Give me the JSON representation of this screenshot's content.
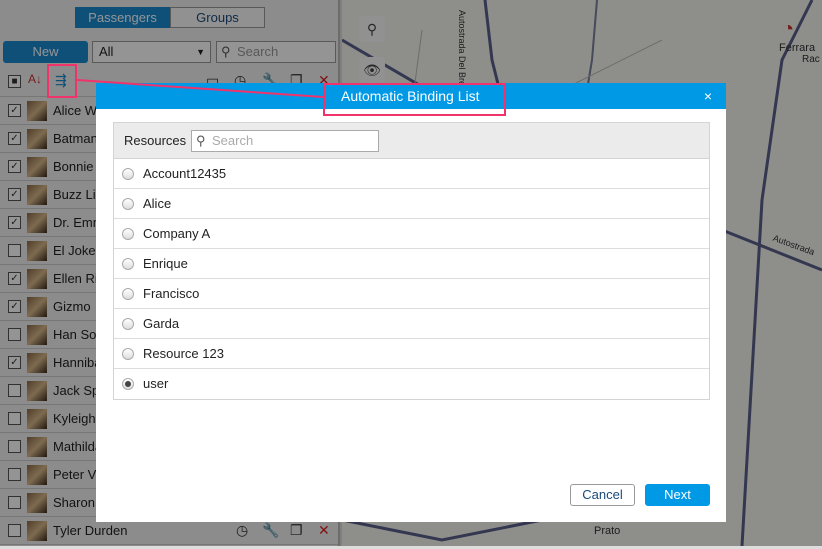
{
  "left_panel": {
    "tabs": [
      {
        "label": "Passengers",
        "active": true
      },
      {
        "label": "Groups",
        "active": false
      }
    ],
    "new_label": "New",
    "filter_value": "All",
    "search_placeholder": "Search",
    "rows": [
      {
        "name": "Alice White",
        "checked": true
      },
      {
        "name": "Batman",
        "checked": true
      },
      {
        "name": "Bonnie Parker",
        "checked": true
      },
      {
        "name": "Buzz Lightyear",
        "checked": true
      },
      {
        "name": "Dr. Emmett Brown",
        "checked": true
      },
      {
        "name": "El Joker",
        "checked": false
      },
      {
        "name": "Ellen Ripley",
        "checked": true
      },
      {
        "name": "Gizmo",
        "checked": true
      },
      {
        "name": "Han Solo",
        "checked": false
      },
      {
        "name": "Hannibal",
        "checked": true
      },
      {
        "name": "Jack Sparrow",
        "checked": false
      },
      {
        "name": "Kyleigh",
        "checked": false
      },
      {
        "name": "Mathilda",
        "checked": false
      },
      {
        "name": "Peter Venkman",
        "checked": false
      },
      {
        "name": "Sharon",
        "checked": false
      },
      {
        "name": "Tyler Durden",
        "checked": false
      }
    ]
  },
  "map": {
    "city": "Ferrara",
    "road": "Autostrada Del Brennero",
    "road2": "Autostrada",
    "town": "Prato",
    "partial": "Rac"
  },
  "dialog": {
    "title": "Automatic Binding List",
    "close": "×",
    "resources_label": "Resources",
    "search_placeholder": "Search",
    "items": [
      {
        "label": "Account12435",
        "selected": false
      },
      {
        "label": "Alice",
        "selected": false
      },
      {
        "label": "Company A",
        "selected": false
      },
      {
        "label": "Enrique",
        "selected": false
      },
      {
        "label": "Francisco",
        "selected": false
      },
      {
        "label": "Garda",
        "selected": false
      },
      {
        "label": "Resource 123",
        "selected": false
      },
      {
        "label": "user",
        "selected": true
      }
    ],
    "cancel": "Cancel",
    "next": "Next"
  },
  "colors": {
    "accent": "#0099e6",
    "highlight": "#f0336a"
  }
}
